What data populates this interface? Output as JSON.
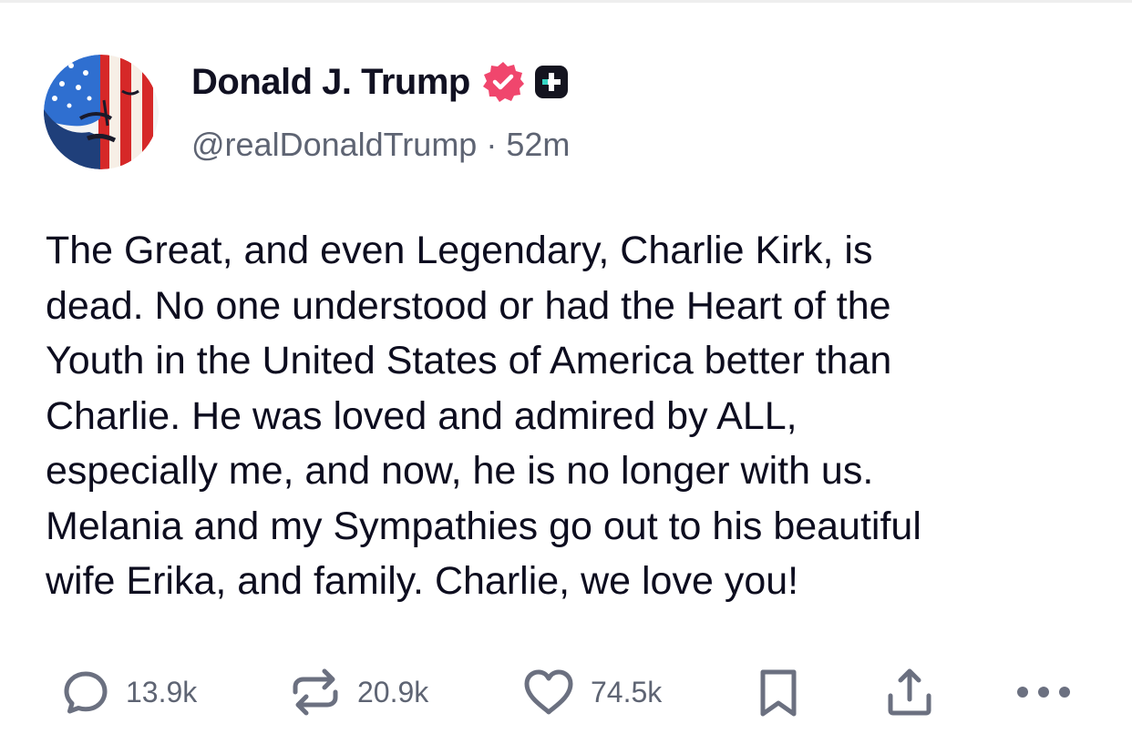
{
  "post": {
    "author": {
      "display_name": "Donald J. Trump",
      "handle": "@realDonaldTrump",
      "separator": "·",
      "time_ago": "52m",
      "verified": true,
      "badge_color": "#f0466d",
      "plus_badge_color": "#14141f",
      "plus_accent_color": "#35d6c4"
    },
    "text": "The Great, and even Legendary, Charlie Kirk, is\ndead. No one understood or had the Heart of the\nYouth in the United States of America better than\nCharlie. He was loved and admired by ALL,\nespecially me, and now, he is no longer with us.\nMelania and my Sympathies go out to his beautiful\nwife Erika, and family. Charlie, we love you!",
    "actions": {
      "replies": "13.9k",
      "reposts": "20.9k",
      "likes": "74.5k",
      "icons": [
        "reply-icon",
        "repost-icon",
        "heart-icon",
        "bookmark-icon",
        "share-icon",
        "more-icon"
      ],
      "icon_color": "#6b7080"
    }
  }
}
